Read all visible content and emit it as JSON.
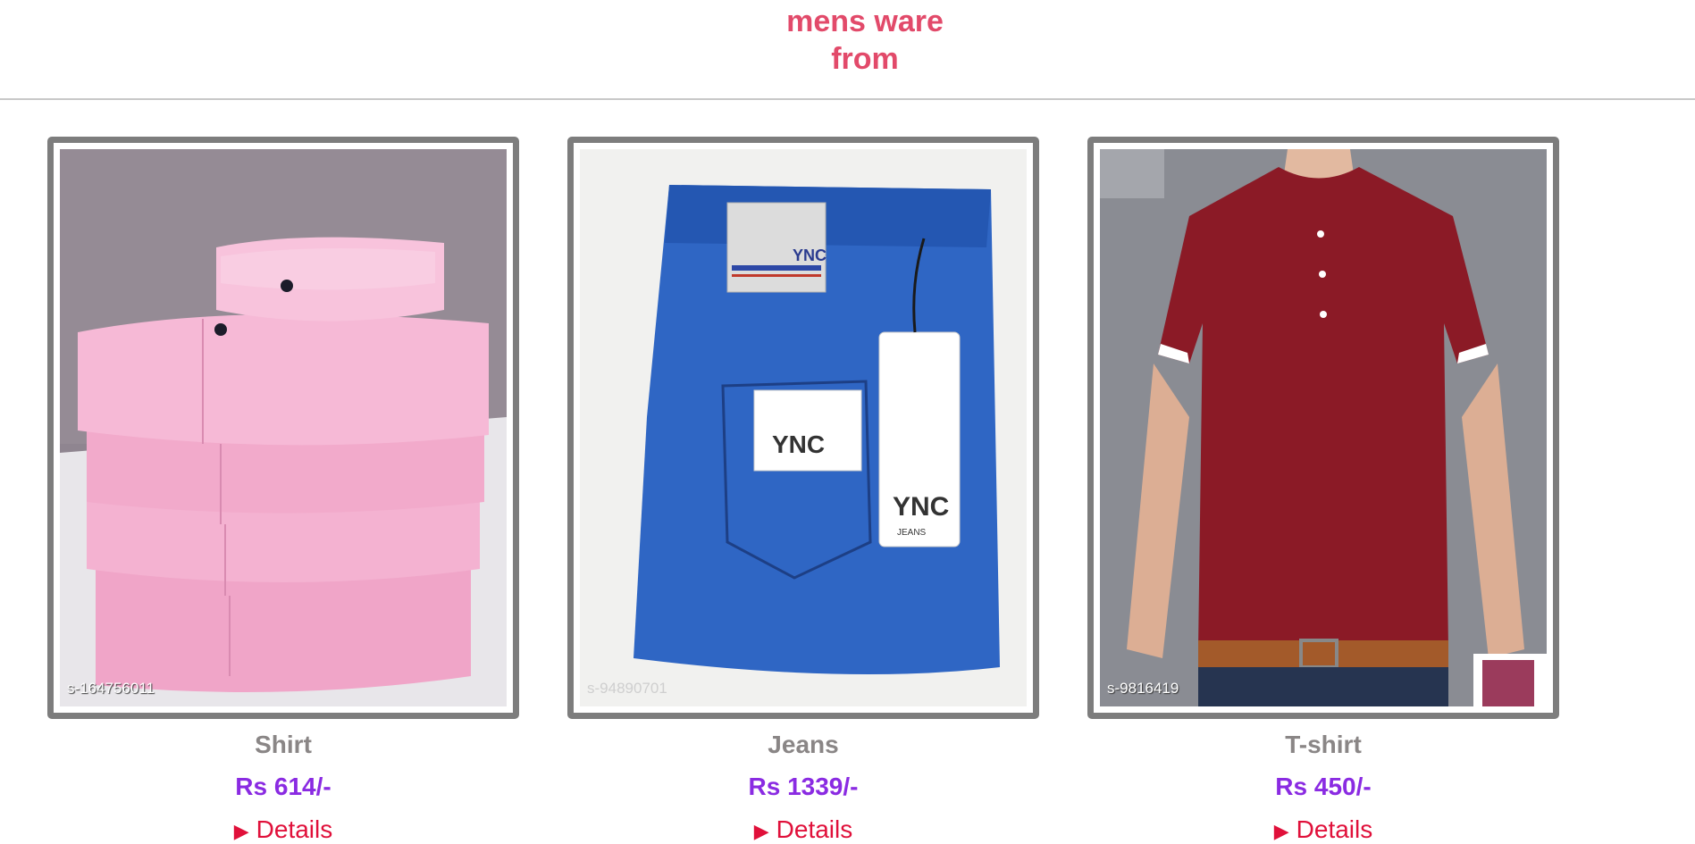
{
  "header": {
    "title_line1": "mens ware",
    "title_line2": "from"
  },
  "products": [
    {
      "name": "Shirt",
      "price": "Rs 614/-",
      "sku": "s-164756011",
      "details_label": "Details",
      "image": "pink-folded-shirts-photo"
    },
    {
      "name": "Jeans",
      "price": "Rs 1339/-",
      "sku": "s-94890701",
      "details_label": "Details",
      "image": "blue-jeans-photo",
      "brand_label": "YNC",
      "brand_sub": "JEANS"
    },
    {
      "name": "T-shirt",
      "price": "Rs 450/-",
      "sku": "s-9816419",
      "details_label": "Details",
      "image": "maroon-tshirt-photo"
    }
  ],
  "colors": {
    "title": "#e24a6a",
    "price": "#8a2be2",
    "details_link": "#e0103a",
    "product_name": "#8a8686",
    "frame": "#7d7d7d"
  }
}
